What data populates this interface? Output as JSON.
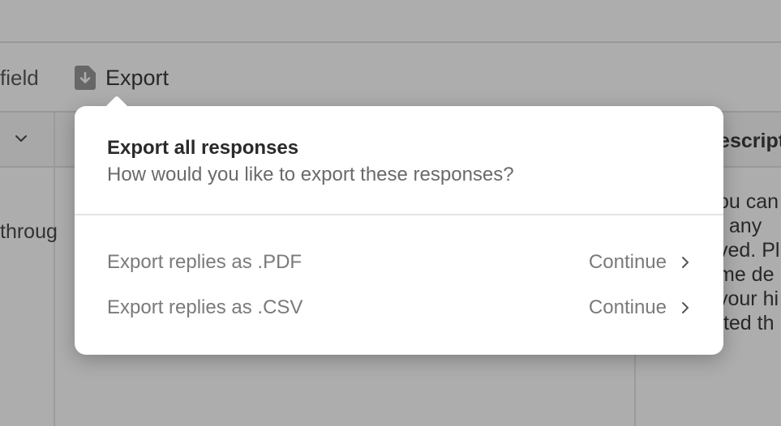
{
  "toolbar": {
    "field_label": "field",
    "export_label": "Export"
  },
  "table": {
    "column_header_partial": "Descript",
    "cell_partial_left": "throug",
    "cell_partial_right": [
      "ou can",
      "t any",
      "ved. Pl",
      "me de",
      "your hi",
      "tted th"
    ]
  },
  "popover": {
    "title": "Export all responses",
    "subtitle": "How would you like to export these responses?",
    "options": [
      {
        "label": "Export replies as .PDF",
        "action": "Continue"
      },
      {
        "label": "Export replies as .CSV",
        "action": "Continue"
      }
    ]
  },
  "icons": {
    "export": "document-download-icon",
    "column_menu": "chevron-down-icon",
    "continue": "chevron-right-icon"
  },
  "colors": {
    "overlay": "#323232",
    "popover_bg": "#ffffff",
    "muted_text": "#7a7a7a"
  }
}
